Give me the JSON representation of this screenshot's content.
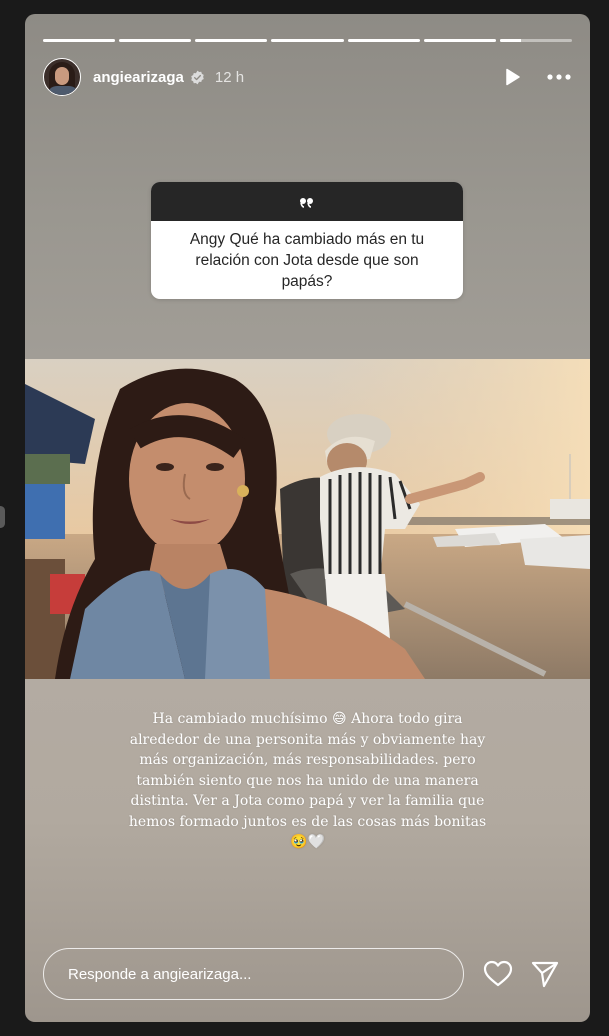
{
  "story": {
    "progress_segments": [
      1,
      1,
      1,
      1,
      1,
      1,
      0.3
    ],
    "username": "angiearizaga",
    "time_ago": "12 h",
    "verified": true
  },
  "question": {
    "icon": "quote-icon",
    "text": "Angy Qué ha cambiado más en tu relación con Jota desde que son papás?"
  },
  "answer": {
    "line1": "Ha cambiado muchísimo ",
    "line1_emoji": "😅",
    "line1_end": " Ahora todo gira",
    "line2": "alrededor de una personita más y obviamente hay",
    "line3": "más organización, más responsabilidades. pero",
    "line4": "también siento que nos ha unido de una manera",
    "line5": "distinta. Ver a Jota como papá y ver la familia que",
    "line6": "hemos formado juntos es de las cosas más bonitas",
    "line7_emoji": "🥹🤍"
  },
  "reply": {
    "placeholder": "Responde a angiearizaga..."
  },
  "colors": {
    "card_header": "#262626",
    "text_light": "#ffffff",
    "verified_blue": "#3897f0"
  }
}
